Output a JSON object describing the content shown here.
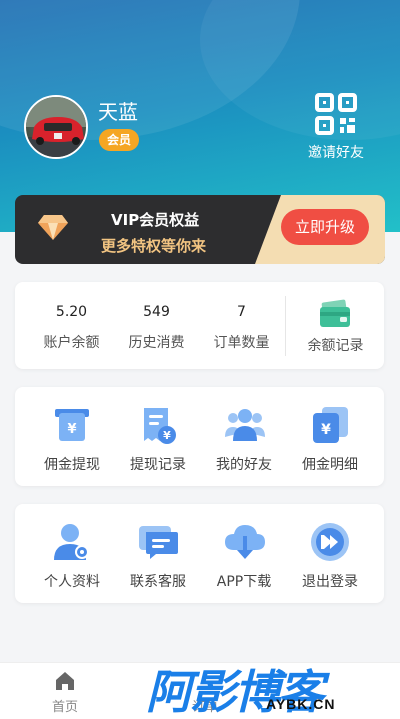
{
  "profile": {
    "username": "天蓝",
    "badge": "会员",
    "invite_label": "邀请好友"
  },
  "vip": {
    "title": "VIP会员权益",
    "subtitle": "更多特权等你来",
    "upgrade_label": "立即升级"
  },
  "stats": [
    {
      "value": "5.20",
      "label": "账户余额"
    },
    {
      "value": "549",
      "label": "历史消费"
    },
    {
      "value": "7",
      "label": "订单数量"
    }
  ],
  "wallet_label": "余额记录",
  "grid1": [
    {
      "label": "佣金提现",
      "icon": "withdraw-icon"
    },
    {
      "label": "提现记录",
      "icon": "record-icon"
    },
    {
      "label": "我的好友",
      "icon": "friends-icon"
    },
    {
      "label": "佣金明细",
      "icon": "commission-icon"
    }
  ],
  "grid2": [
    {
      "label": "个人资料",
      "icon": "profile-icon"
    },
    {
      "label": "联系客服",
      "icon": "service-icon"
    },
    {
      "label": "APP下载",
      "icon": "download-icon"
    },
    {
      "label": "退出登录",
      "icon": "logout-icon"
    }
  ],
  "tabs": [
    {
      "label": "首页"
    },
    {
      "label": "订单"
    }
  ],
  "watermark": {
    "main": "阿影博客",
    "sub": "AYBK.CN"
  },
  "colors": {
    "header_start": "#1f6fb4",
    "header_end": "#22c0c8",
    "accent_blue": "#5b9cf0",
    "upgrade_red": "#f04e43",
    "badge_orange": "#f5a623",
    "vip_gold": "#f2c482"
  }
}
